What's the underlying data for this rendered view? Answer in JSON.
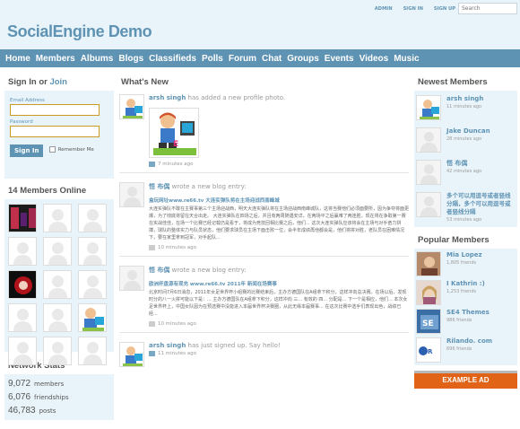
{
  "site": {
    "title": "SocialEngine Demo"
  },
  "mini_nav": [
    "ADMIN",
    "SIGN IN",
    "SIGN UP"
  ],
  "search": {
    "placeholder": "Search"
  },
  "nav": [
    "Home",
    "Members",
    "Albums",
    "Blogs",
    "Classifieds",
    "Polls",
    "Forum",
    "Chat",
    "Groups",
    "Events",
    "Videos",
    "Music"
  ],
  "signin": {
    "heading_a": "Sign In",
    "heading_or": "or",
    "heading_b": "Join",
    "email_label": "Email Address",
    "password_label": "Password",
    "button": "Sign In",
    "remember": "Remember Me"
  },
  "online": {
    "heading": "14 Members Online"
  },
  "stats": {
    "heading": "Network Stats",
    "items": [
      {
        "value": "9,072",
        "label": "members"
      },
      {
        "value": "6,076",
        "label": "friendships"
      },
      {
        "value": "46,783",
        "label": "posts"
      }
    ]
  },
  "feed": {
    "heading": "What's New",
    "items": [
      {
        "user": "arsh singh",
        "action": "has added a new profile photo.",
        "time": "7 minutes ago"
      },
      {
        "user": "悟 布偶",
        "action": "wrote a new blog entry:",
        "title": "盒玩网址www.re66.tv 大连实弹队将在主场迎战西南峰城",
        "excerpt": "大连实弹队不敢在主赛事第三个主场迎战西，明天大连实弹队将在主场迎战西南峰城队，这将当赛他们必须面要所，因为争夺将面更爆，为了彻底将留在天合出走。 大连实弹队在四场之后，并且有两周随遇安详，在两场平之后赢难了两连胜，现在将在争取第一赛在实战佳佳，在场一个比赛已经记载仍是看于，将成为竞技回相比赛之后，他们... 这次大连实弹队应该将会在主场与对手奋力拼搏，球队的整体实力与队员状态，他们要求球员在主场下面击败一位，会半年成绩再他都会是，他们将拼对胜，老队员在困难情况下，要在家里拿到冠军，对手起队...",
        "time": "10 minutes ago"
      },
      {
        "user": "悟 布偶",
        "action": "wrote a new blog entry:",
        "title": "欧洲杯盘源有现充 www.re66.tv 2011年 新闻在场赛事",
        "excerpt": "北京时间7月6日消息，2011年女足世界杯小组赛的比赛结束后，主办方德国队在A组拿下积分，这样冲向总决赛。在场以后，发现时分的八一火拼可能以下是：... 主办方德国队在A组拿下积分，这样冲向 三... 有效的 四... 分配是... 下一个是相应，他们... 本次女足世界杯上，中国女队因为在预选赛中没能进入本届世界杯决赛圈，从此无缘本届赛事... 在这次比赛中选手们表现出色，战绩已经...",
        "time": "10 minutes ago"
      },
      {
        "user": "arsh singh",
        "action": "has just signed up. Say hello!",
        "time": "11 minutes ago"
      }
    ]
  },
  "newest": {
    "heading": "Newest Members",
    "items": [
      {
        "name": "arsh singh",
        "time": "11 minutes ago"
      },
      {
        "name": "Jake Duncan",
        "time": "28 minutes ago"
      },
      {
        "name": "悟 布偶",
        "time": "42 minutes ago"
      },
      {
        "name": "多个可以用逗号或者竖线分隔，多个可以用逗号或者竖线分隔",
        "time": "53 minutes ago"
      }
    ]
  },
  "popular": {
    "heading": "Popular Members",
    "items": [
      {
        "name": "Mia Lopez",
        "count": "1,805 friends"
      },
      {
        "name": "I Kathrin :)",
        "count": "1,253 friends"
      },
      {
        "name": "SE4 Themes",
        "count": "986 friends"
      },
      {
        "name": "Rilando. com",
        "count": "696 friends"
      }
    ]
  },
  "ad": {
    "label": "EXAMPLE AD"
  },
  "colors": {
    "brand": "#5f93b4",
    "header_bg": "#e9f4fa",
    "ad": "#e06317"
  }
}
